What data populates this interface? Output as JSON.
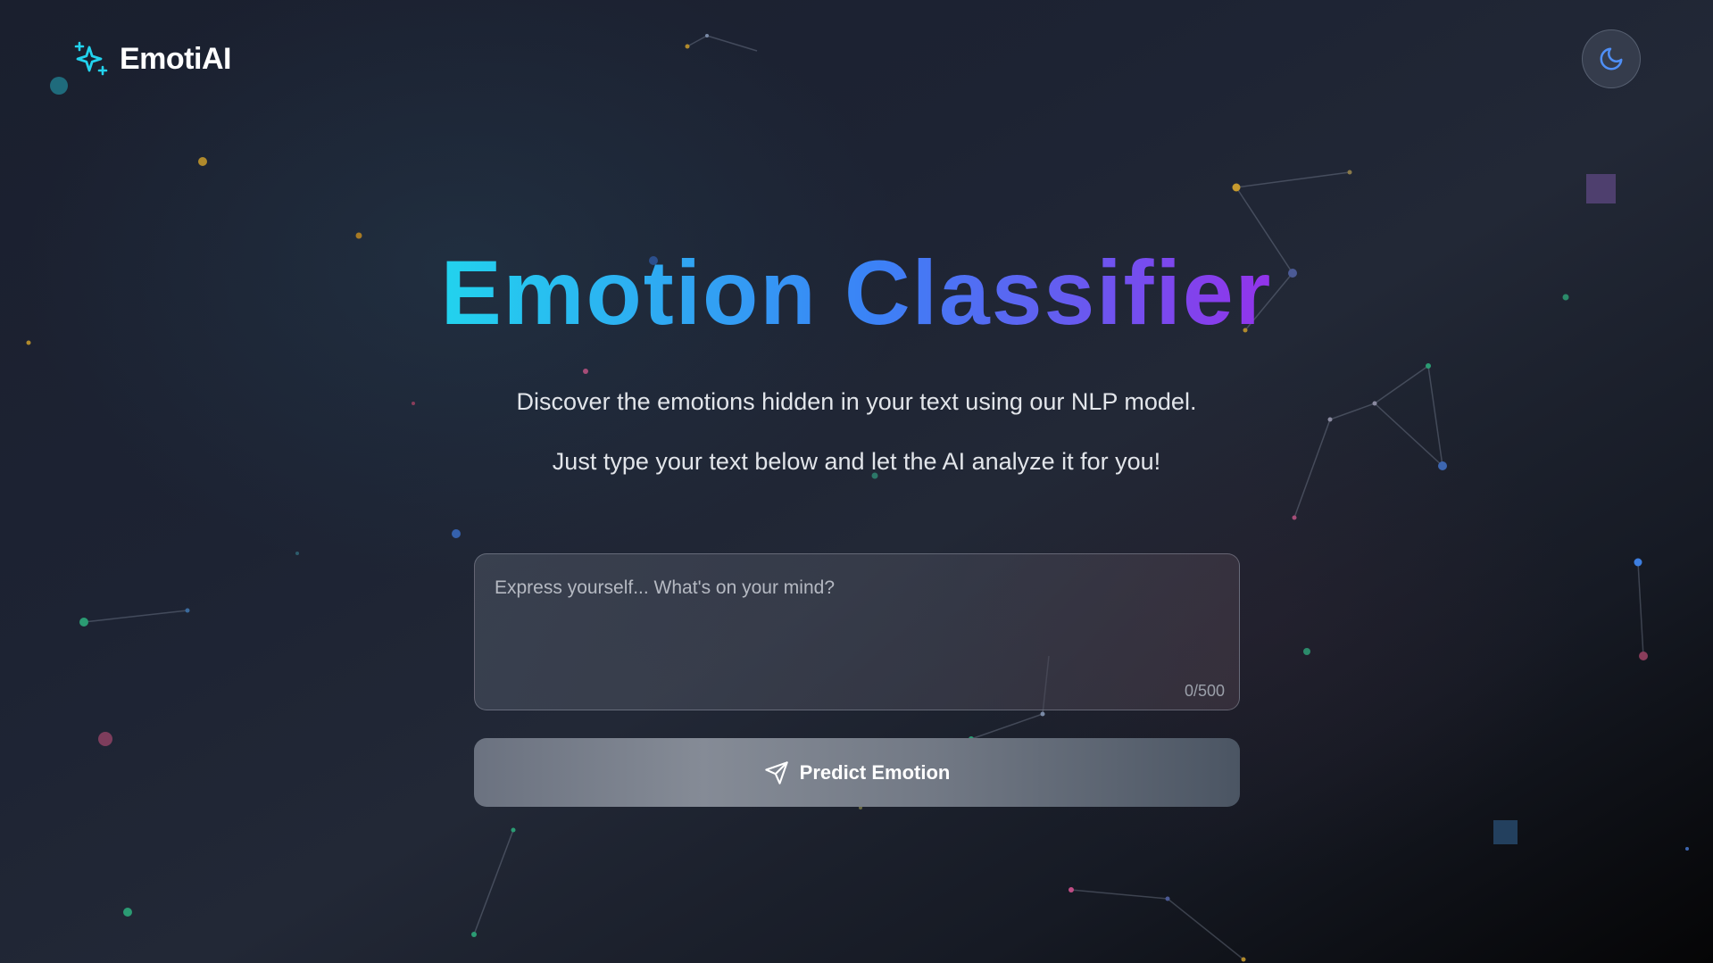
{
  "header": {
    "brand": "EmotiAI",
    "brand_icon": "sparkles-icon",
    "theme_toggle_icon": "moon-icon"
  },
  "hero": {
    "title": "Emotion Classifier",
    "subtitle_line1": "Discover the emotions hidden in your text using our NLP model.",
    "subtitle_line2": "Just type your text below and let the AI analyze it for you!"
  },
  "input": {
    "value": "",
    "placeholder": "Express yourself... What's on your mind?",
    "counter": "0/500"
  },
  "predict": {
    "label": "Predict Emotion",
    "icon": "send-icon"
  },
  "colors": {
    "accent_cyan": "#22d3ee",
    "accent_blue": "#3b82f6",
    "accent_purple": "#9333ea",
    "background": "#1c2130"
  }
}
